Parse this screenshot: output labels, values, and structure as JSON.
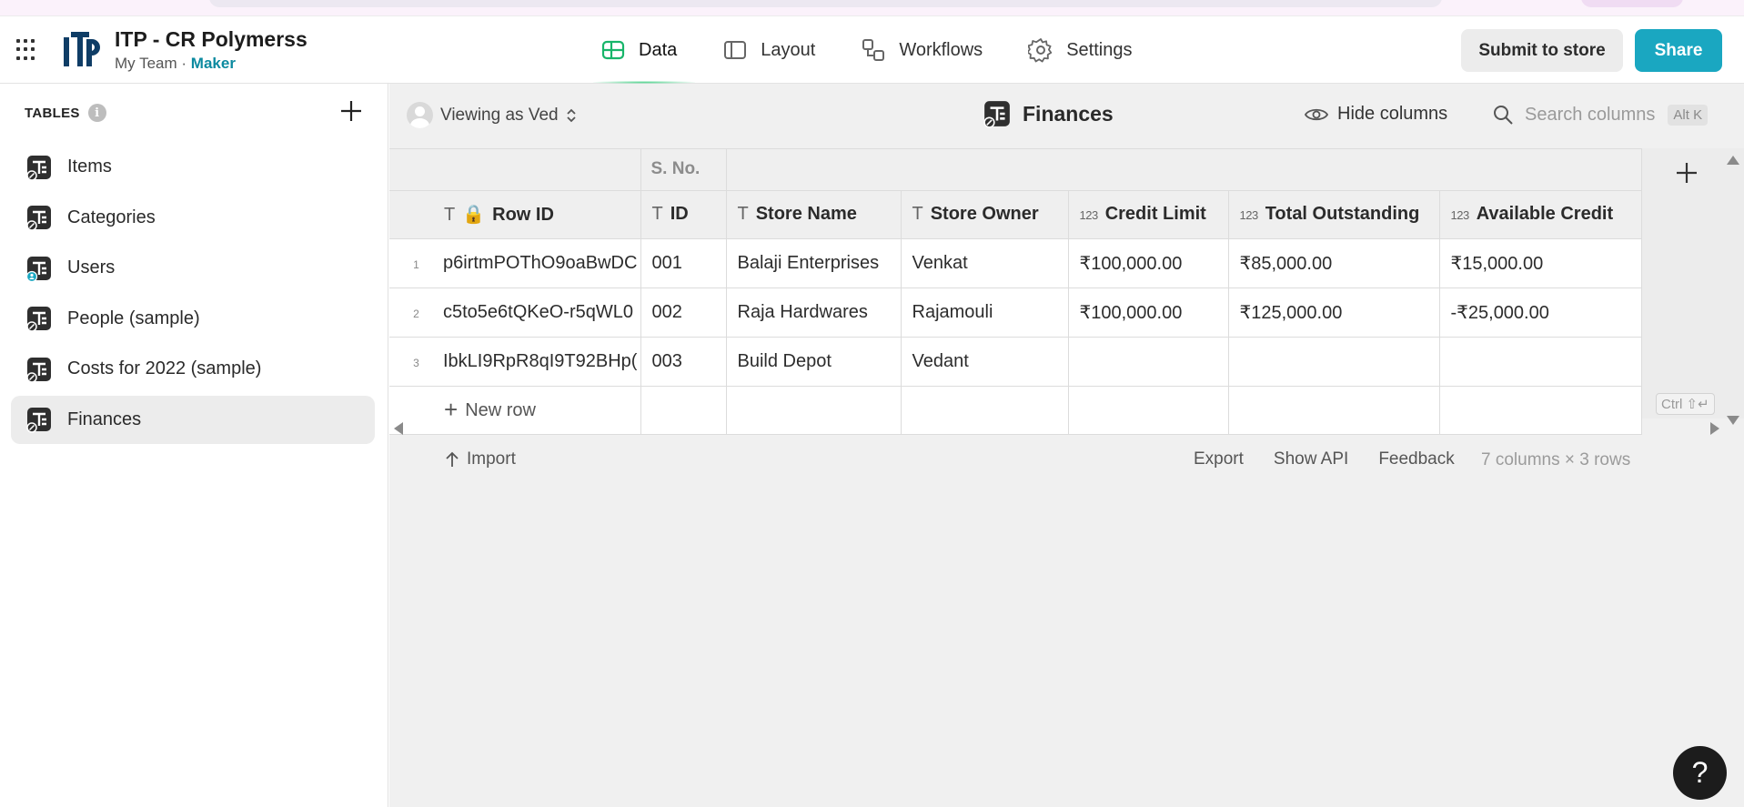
{
  "app": {
    "title": "ITP - CR Polymerss",
    "team": "My Team",
    "separator": "·",
    "role": "Maker",
    "logo_text": "ITP"
  },
  "nav": [
    {
      "label": "Data",
      "icon": "table-icon",
      "active": true
    },
    {
      "label": "Layout",
      "icon": "layout-icon",
      "active": false
    },
    {
      "label": "Workflows",
      "icon": "workflow-icon",
      "active": false
    },
    {
      "label": "Settings",
      "icon": "gear-icon",
      "active": false
    }
  ],
  "header_buttons": {
    "submit": "Submit to store",
    "share": "Share"
  },
  "sidebar": {
    "heading": "TABLES",
    "items": [
      {
        "label": "Items",
        "active": false
      },
      {
        "label": "Categories",
        "active": false
      },
      {
        "label": "Users",
        "active": false
      },
      {
        "label": "People (sample)",
        "active": false
      },
      {
        "label": "Costs for 2022 (sample)",
        "active": false
      },
      {
        "label": "Finances",
        "active": true
      }
    ]
  },
  "toolbar": {
    "viewing": "Viewing as Ved",
    "table_title": "Finances",
    "hide_columns": "Hide columns",
    "search_placeholder": "Search columns",
    "search_shortcut": "Alt K"
  },
  "grid": {
    "group_label": "S. No.",
    "columns": [
      {
        "label": "Row ID",
        "type": "T",
        "locked": true
      },
      {
        "label": "ID",
        "type": "T"
      },
      {
        "label": "Store Name",
        "type": "T"
      },
      {
        "label": "Store Owner",
        "type": "T"
      },
      {
        "label": "Credit Limit",
        "type": "123"
      },
      {
        "label": "Total Outstanding",
        "type": "123"
      },
      {
        "label": "Available Credit",
        "type": "123"
      }
    ],
    "rows": [
      {
        "num": "1",
        "row_id": "p6irtmPOThO9oaBwDC",
        "id": "001",
        "store_name": "Balaji Enterprises",
        "store_owner": "Venkat",
        "credit_limit": "₹100,000.00",
        "total_outstanding": "₹85,000.00",
        "available_credit": "₹15,000.00"
      },
      {
        "num": "2",
        "row_id": "c5to5e6tQKeO-r5qWL0",
        "id": "002",
        "store_name": "Raja Hardwares",
        "store_owner": "Rajamouli",
        "credit_limit": "₹100,000.00",
        "total_outstanding": "₹125,000.00",
        "available_credit": "-₹25,000.00"
      },
      {
        "num": "3",
        "row_id": "IbkLI9RpR8qI9T92BHp(",
        "id": "003",
        "store_name": "Build Depot",
        "store_owner": "Vedant",
        "credit_limit": "",
        "total_outstanding": "",
        "available_credit": ""
      }
    ],
    "new_row": "New row",
    "new_row_shortcut": "Ctrl ⇧↵"
  },
  "footer": {
    "import": "Import",
    "export": "Export",
    "show_api": "Show API",
    "feedback": "Feedback",
    "summary": "7 columns × 3 rows"
  },
  "help": "?",
  "colors": {
    "accent": "#1aa7c1",
    "role": "#0c8aa0",
    "active_tab": "#4ad28a"
  }
}
